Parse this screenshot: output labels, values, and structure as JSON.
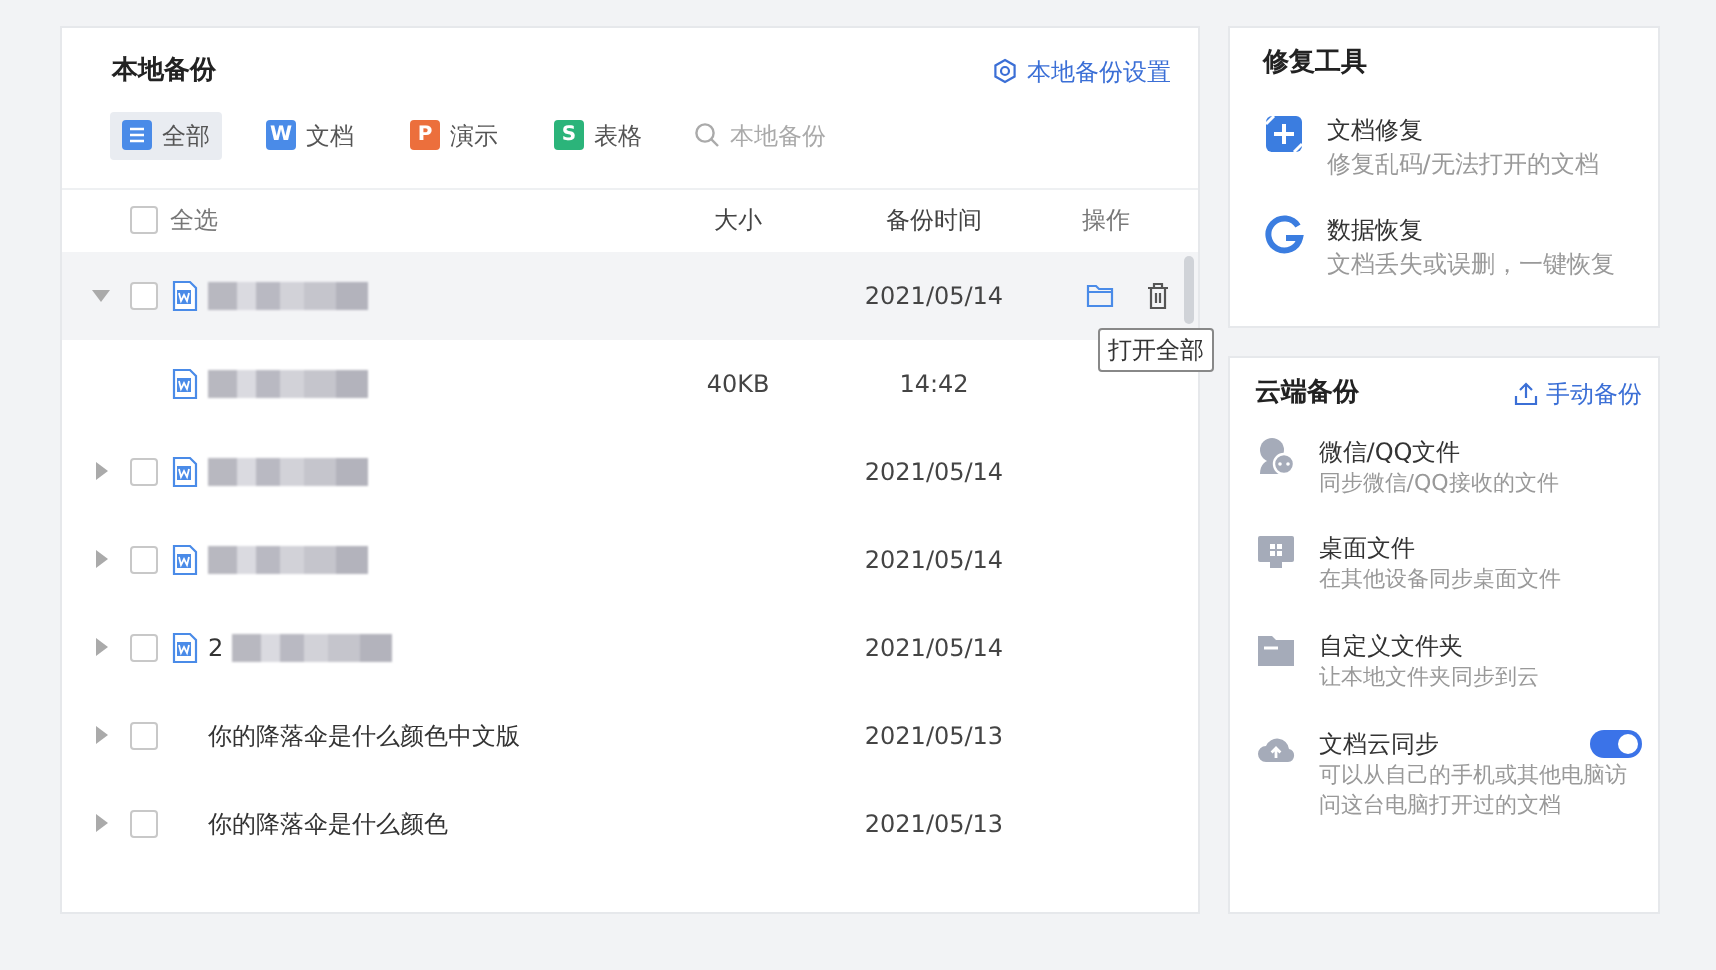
{
  "local_backup": {
    "title": "本地备份",
    "settings_link": "本地备份设置",
    "filters": [
      {
        "kind": "all",
        "label": "全部",
        "color": "#4a8be8",
        "selected": true
      },
      {
        "kind": "letter",
        "letter": "W",
        "label": "文档",
        "color": "#4a8be8",
        "selected": false
      },
      {
        "kind": "letter",
        "letter": "P",
        "label": "演示",
        "color": "#ec6f3c",
        "selected": false
      },
      {
        "kind": "letter",
        "letter": "S",
        "label": "表格",
        "color": "#2bb47a",
        "selected": false
      }
    ],
    "search": {
      "placeholder": "本地备份"
    },
    "columns": {
      "select_all": "全选",
      "select_all_checked": false,
      "size": "大小",
      "time": "备份时间",
      "actions": "操作"
    },
    "rows": [
      {
        "kind": "group",
        "expanded": true,
        "highlighted": true,
        "checked": false,
        "doc_icon": true,
        "name_blurred": true,
        "time": "2021/05/14",
        "tooltip": "打开全部",
        "children": [
          {
            "doc_icon": true,
            "name_blurred": true,
            "size": "40KB",
            "time": "14:42"
          }
        ]
      },
      {
        "kind": "group",
        "expanded": false,
        "highlighted": false,
        "checked": false,
        "doc_icon": true,
        "name_blurred": true,
        "time": "2021/05/14"
      },
      {
        "kind": "group",
        "expanded": false,
        "highlighted": false,
        "checked": false,
        "doc_icon": true,
        "name_blurred": true,
        "time": "2021/05/14"
      },
      {
        "kind": "group",
        "expanded": false,
        "highlighted": false,
        "checked": false,
        "doc_icon": true,
        "name": "2",
        "name_blurred": true,
        "time": "2021/05/14"
      },
      {
        "kind": "group",
        "expanded": false,
        "highlighted": false,
        "checked": false,
        "doc_icon": false,
        "name": "你的降落伞是什么颜色中文版",
        "name_blurred": false,
        "time": "2021/05/13"
      },
      {
        "kind": "group",
        "expanded": false,
        "highlighted": false,
        "checked": false,
        "doc_icon": false,
        "name": "你的降落伞是什么颜色",
        "name_blurred": false,
        "time": "2021/05/13"
      }
    ]
  },
  "repair_tools": {
    "title": "修复工具",
    "items": [
      {
        "title": "文档修复",
        "desc": "修复乱码/无法打开的文档"
      },
      {
        "title": "数据恢复",
        "desc": "文档丢失或误删，一键恢复"
      }
    ]
  },
  "cloud_backup": {
    "title": "云端备份",
    "action": "手动备份",
    "items": [
      {
        "kind": "plain",
        "title": "微信/QQ文件",
        "desc": "同步微信/QQ接收的文件"
      },
      {
        "kind": "plain",
        "title": "桌面文件",
        "desc": "在其他设备同步桌面文件"
      },
      {
        "kind": "plain",
        "title": "自定义文件夹",
        "desc": "让本地文件夹同步到云"
      },
      {
        "kind": "toggle",
        "on": true,
        "title": "文档云同步",
        "desc": "可以从自己的手机或其他电脑访问这台电脑打开过的文档"
      }
    ]
  }
}
